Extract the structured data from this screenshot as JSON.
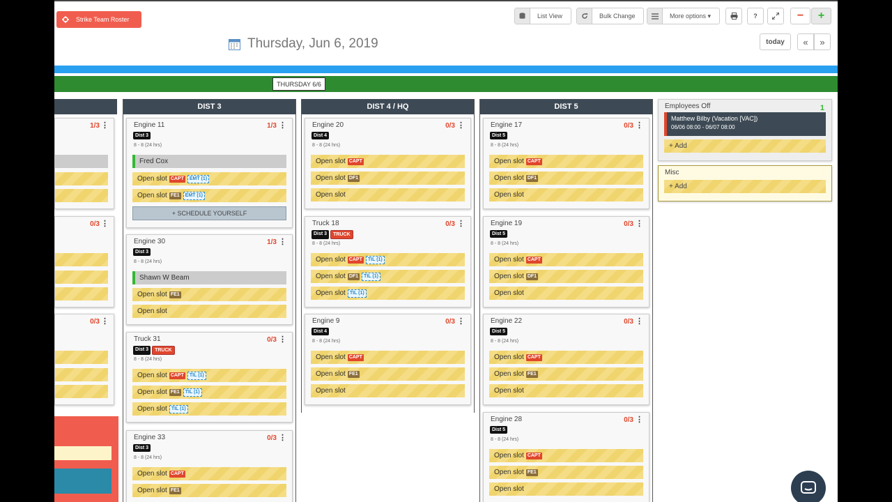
{
  "toolbar": {
    "strike_team": "Strike Team Roster",
    "list_view": "List View",
    "bulk_change": "Bulk Change",
    "more_options": "More options ▾",
    "print_icon": "printer-icon",
    "help": "?",
    "zoom_out": "−",
    "zoom_in": "+"
  },
  "header": {
    "date": "Thursday, Jun 6, 2019",
    "today": "today",
    "prev": "«",
    "next": "»",
    "day_label": "THURSDAY 6/6"
  },
  "colors": {
    "accent_red": "#f05d4e",
    "blue": "#2aa0f0",
    "green": "#2e8b30",
    "header": "#3d4a55"
  },
  "columns": [
    {
      "title": "DIST 3"
    },
    {
      "title": "DIST 4 / HQ"
    },
    {
      "title": "DIST 5"
    }
  ],
  "left_col": {
    "counts": [
      "1/3",
      "0/3",
      "0/3"
    ]
  },
  "dist3": {
    "engine11": {
      "name": "Engine 11",
      "count": "1/3",
      "dist": "Dist 3",
      "hours": "8 - 8 (24 hrs)",
      "s1": "Fred Cox",
      "s2": "Open slot",
      "s3": "Open slot",
      "schedule": "+ SCHEDULE YOURSELF"
    },
    "engine30": {
      "name": "Engine 30",
      "count": "1/3",
      "dist": "Dist 3",
      "hours": "8 - 8 (24 hrs)",
      "s1": "Shawn W Beam",
      "s2": "Open slot",
      "s3": "Open slot"
    },
    "truck31": {
      "name": "Truck 31",
      "count": "0/3",
      "dist": "Dist 3",
      "truck": "TRUCK",
      "hours": "8 - 8 (24 hrs)",
      "s1": "Open slot",
      "s2": "Open slot",
      "s3": "Open slot"
    },
    "engine33": {
      "name": "Engine 33",
      "count": "0/3",
      "dist": "Dist 3",
      "hours": "8 - 8 (24 hrs)",
      "s1": "Open slot",
      "s2": "Open slot"
    }
  },
  "dist4": {
    "engine20": {
      "name": "Engine 20",
      "count": "0/3",
      "dist": "Dist 4",
      "hours": "8 - 8 (24 hrs)",
      "s1": "Open slot",
      "s2": "Open slot",
      "s3": "Open slot"
    },
    "truck18": {
      "name": "Truck 18",
      "count": "0/3",
      "dist": "Dist 3",
      "truck": "TRUCK",
      "hours": "8 - 8 (24 hrs)",
      "s1": "Open slot",
      "s2": "Open slot",
      "s3": "Open slot"
    },
    "engine9": {
      "name": "Engine 9",
      "count": "0/3",
      "dist": "Dist 4",
      "hours": "8 - 8 (24 hrs)",
      "s1": "Open slot",
      "s2": "Open slot",
      "s3": "Open slot"
    }
  },
  "dist5": {
    "engine17": {
      "name": "Engine 17",
      "count": "0/3",
      "dist": "Dist 5",
      "hours": "8 - 8 (24 hrs)",
      "s1": "Open slot",
      "s2": "Open slot",
      "s3": "Open slot"
    },
    "engine19": {
      "name": "Engine 19",
      "count": "0/3",
      "dist": "Dist 5",
      "hours": "8 - 8 (24 hrs)",
      "s1": "Open slot",
      "s2": "Open slot",
      "s3": "Open slot"
    },
    "engine22": {
      "name": "Engine 22",
      "count": "0/3",
      "dist": "Dist 5",
      "hours": "8 - 8 (24 hrs)",
      "s1": "Open slot",
      "s2": "Open slot",
      "s3": "Open slot"
    },
    "engine28": {
      "name": "Engine 28",
      "count": "0/3",
      "dist": "Dist 5",
      "hours": "8 - 8 (24 hrs)",
      "s1": "Open slot",
      "s2": "Open slot",
      "s3": "Open slot"
    }
  },
  "roles": {
    "capt": "CAPT",
    "fe": "FE1",
    "df": "DF1",
    "emt": "EMT (1)",
    "til": "TIL (1)",
    "pm": "PM"
  },
  "employees_off": {
    "title": "Employees Off",
    "count": "1",
    "name": "Matthew Bilby (Vacation [VAC])",
    "range": "06/06 08:00 - 06/07 08:00",
    "add": "+ Add"
  },
  "misc": {
    "title": "Misc",
    "add": "+ Add"
  }
}
